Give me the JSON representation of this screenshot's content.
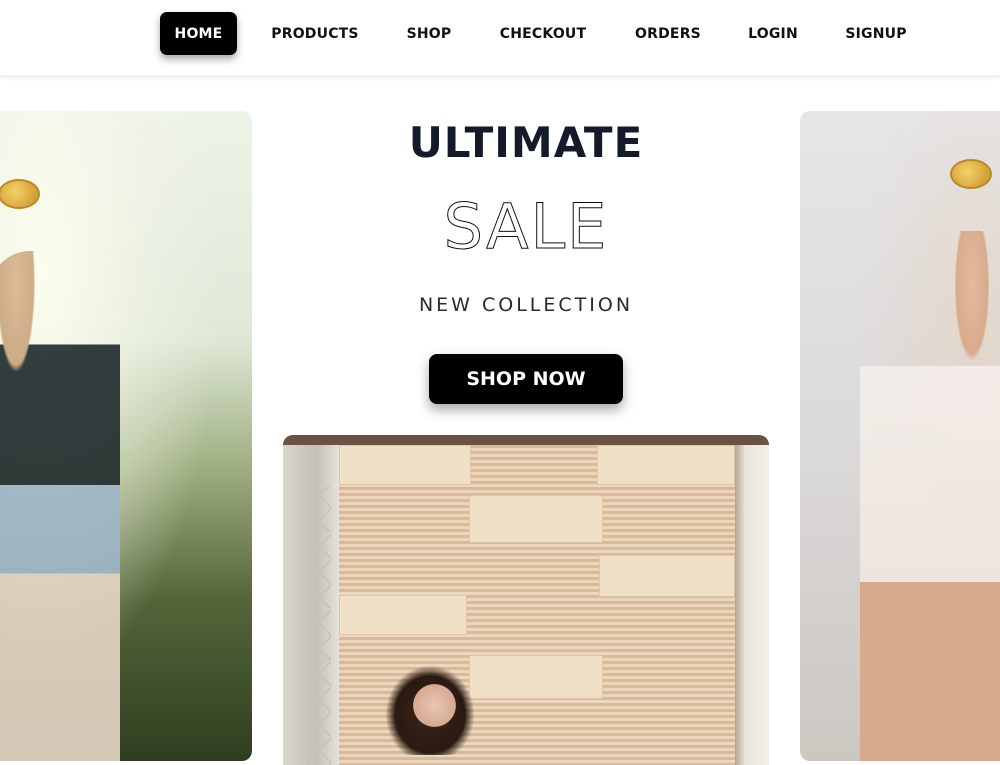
{
  "nav": {
    "items": [
      {
        "label": "HOME",
        "active": true
      },
      {
        "label": "PRODUCTS",
        "active": false
      },
      {
        "label": "SHOP",
        "active": false
      },
      {
        "label": "CHECKOUT",
        "active": false
      },
      {
        "label": "ORDERS",
        "active": false
      },
      {
        "label": "LOGIN",
        "active": false
      },
      {
        "label": "SIGNUP",
        "active": false
      }
    ]
  },
  "hero": {
    "title": "ULTIMATE",
    "sale": "SALE",
    "subtitle": "NEW COLLECTION",
    "cta_label": "SHOP NOW"
  },
  "colors": {
    "accent": "#000000",
    "title_text": "#151a2a",
    "background": "#ffffff"
  }
}
